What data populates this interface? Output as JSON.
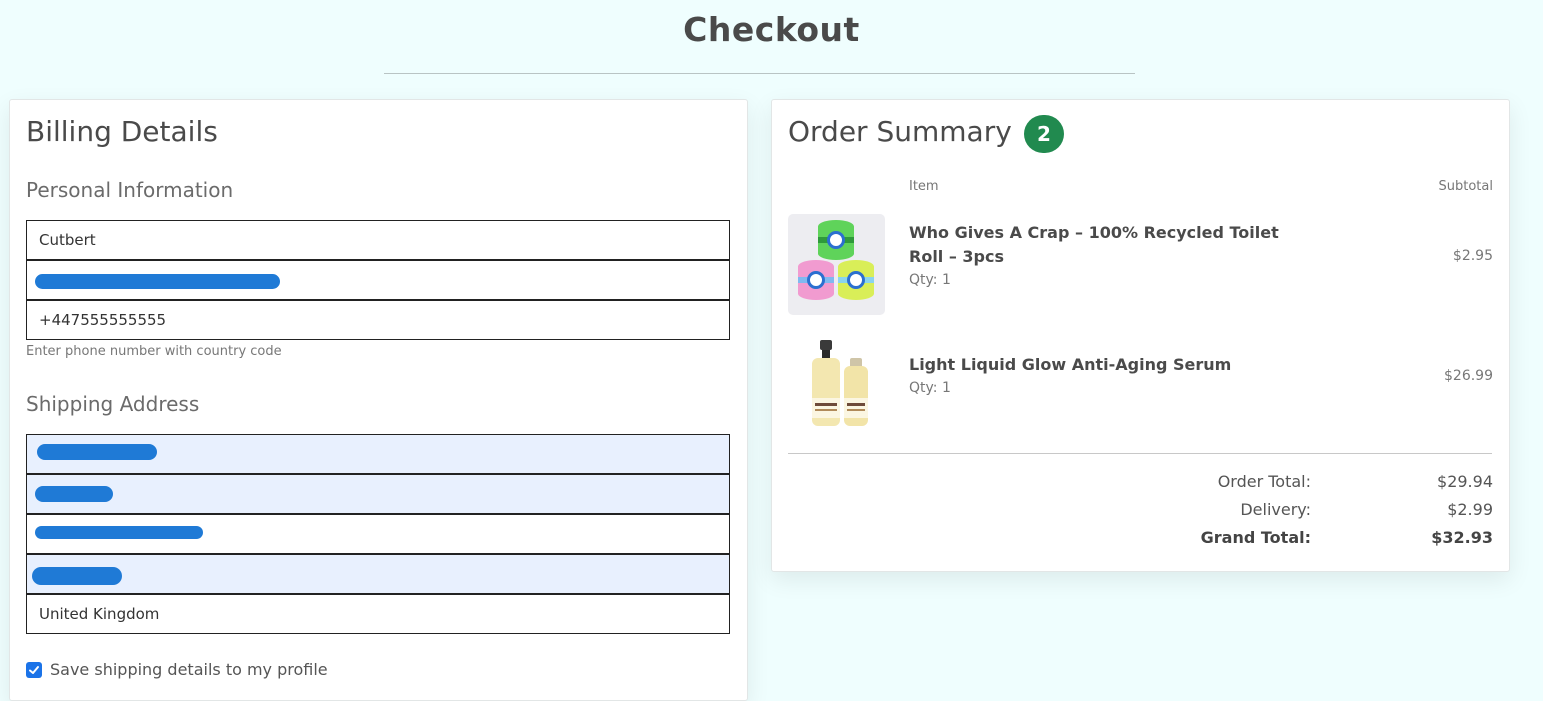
{
  "page": {
    "title": "Checkout"
  },
  "billing": {
    "title": "Billing Details",
    "personal": {
      "heading": "Personal Information",
      "first_name": "Cutbert",
      "phone": "+447555555555",
      "phone_help": "Enter phone number with country code"
    },
    "shipping": {
      "heading": "Shipping Address",
      "country": "United Kingdom"
    },
    "save_label": "Save shipping details to my profile",
    "save_checked": true
  },
  "summary": {
    "title": "Order Summary",
    "count": "2",
    "col_item": "Item",
    "col_subtotal": "Subtotal",
    "items": [
      {
        "name": "Who Gives A Crap – 100% Recycled Toilet Roll – 3pcs",
        "qty": "Qty: 1",
        "price": "$2.95",
        "icon": "toilet-roll-image"
      },
      {
        "name": "Light Liquid Glow Anti-Aging Serum",
        "qty": "Qty: 1",
        "price": "$26.99",
        "icon": "serum-bottles-image"
      }
    ],
    "order_total_label": "Order Total:",
    "order_total": "$29.94",
    "delivery_label": "Delivery:",
    "delivery": "$2.99",
    "grand_total_label": "Grand Total:",
    "grand_total": "$32.93"
  },
  "colors": {
    "page_bg": "#effefe",
    "badge": "#218a4f",
    "autofill_bg": "#e8f0fe",
    "checkbox": "#1b73e8",
    "redaction": "#1f7ad6"
  }
}
